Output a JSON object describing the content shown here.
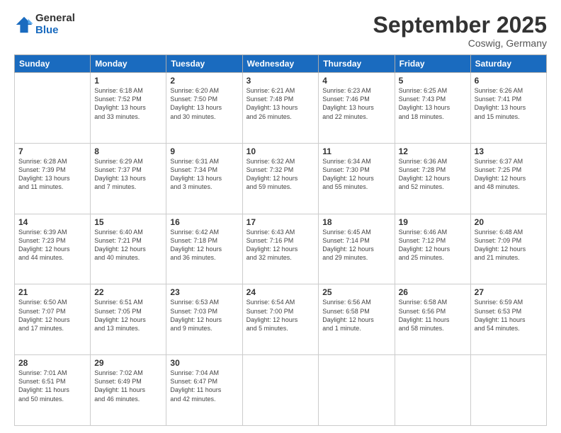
{
  "logo": {
    "general": "General",
    "blue": "Blue"
  },
  "title": "September 2025",
  "location": "Coswig, Germany",
  "days_header": [
    "Sunday",
    "Monday",
    "Tuesday",
    "Wednesday",
    "Thursday",
    "Friday",
    "Saturday"
  ],
  "weeks": [
    [
      {
        "day": "",
        "info": ""
      },
      {
        "day": "1",
        "info": "Sunrise: 6:18 AM\nSunset: 7:52 PM\nDaylight: 13 hours\nand 33 minutes."
      },
      {
        "day": "2",
        "info": "Sunrise: 6:20 AM\nSunset: 7:50 PM\nDaylight: 13 hours\nand 30 minutes."
      },
      {
        "day": "3",
        "info": "Sunrise: 6:21 AM\nSunset: 7:48 PM\nDaylight: 13 hours\nand 26 minutes."
      },
      {
        "day": "4",
        "info": "Sunrise: 6:23 AM\nSunset: 7:46 PM\nDaylight: 13 hours\nand 22 minutes."
      },
      {
        "day": "5",
        "info": "Sunrise: 6:25 AM\nSunset: 7:43 PM\nDaylight: 13 hours\nand 18 minutes."
      },
      {
        "day": "6",
        "info": "Sunrise: 6:26 AM\nSunset: 7:41 PM\nDaylight: 13 hours\nand 15 minutes."
      }
    ],
    [
      {
        "day": "7",
        "info": "Sunrise: 6:28 AM\nSunset: 7:39 PM\nDaylight: 13 hours\nand 11 minutes."
      },
      {
        "day": "8",
        "info": "Sunrise: 6:29 AM\nSunset: 7:37 PM\nDaylight: 13 hours\nand 7 minutes."
      },
      {
        "day": "9",
        "info": "Sunrise: 6:31 AM\nSunset: 7:34 PM\nDaylight: 13 hours\nand 3 minutes."
      },
      {
        "day": "10",
        "info": "Sunrise: 6:32 AM\nSunset: 7:32 PM\nDaylight: 12 hours\nand 59 minutes."
      },
      {
        "day": "11",
        "info": "Sunrise: 6:34 AM\nSunset: 7:30 PM\nDaylight: 12 hours\nand 55 minutes."
      },
      {
        "day": "12",
        "info": "Sunrise: 6:36 AM\nSunset: 7:28 PM\nDaylight: 12 hours\nand 52 minutes."
      },
      {
        "day": "13",
        "info": "Sunrise: 6:37 AM\nSunset: 7:25 PM\nDaylight: 12 hours\nand 48 minutes."
      }
    ],
    [
      {
        "day": "14",
        "info": "Sunrise: 6:39 AM\nSunset: 7:23 PM\nDaylight: 12 hours\nand 44 minutes."
      },
      {
        "day": "15",
        "info": "Sunrise: 6:40 AM\nSunset: 7:21 PM\nDaylight: 12 hours\nand 40 minutes."
      },
      {
        "day": "16",
        "info": "Sunrise: 6:42 AM\nSunset: 7:18 PM\nDaylight: 12 hours\nand 36 minutes."
      },
      {
        "day": "17",
        "info": "Sunrise: 6:43 AM\nSunset: 7:16 PM\nDaylight: 12 hours\nand 32 minutes."
      },
      {
        "day": "18",
        "info": "Sunrise: 6:45 AM\nSunset: 7:14 PM\nDaylight: 12 hours\nand 29 minutes."
      },
      {
        "day": "19",
        "info": "Sunrise: 6:46 AM\nSunset: 7:12 PM\nDaylight: 12 hours\nand 25 minutes."
      },
      {
        "day": "20",
        "info": "Sunrise: 6:48 AM\nSunset: 7:09 PM\nDaylight: 12 hours\nand 21 minutes."
      }
    ],
    [
      {
        "day": "21",
        "info": "Sunrise: 6:50 AM\nSunset: 7:07 PM\nDaylight: 12 hours\nand 17 minutes."
      },
      {
        "day": "22",
        "info": "Sunrise: 6:51 AM\nSunset: 7:05 PM\nDaylight: 12 hours\nand 13 minutes."
      },
      {
        "day": "23",
        "info": "Sunrise: 6:53 AM\nSunset: 7:03 PM\nDaylight: 12 hours\nand 9 minutes."
      },
      {
        "day": "24",
        "info": "Sunrise: 6:54 AM\nSunset: 7:00 PM\nDaylight: 12 hours\nand 5 minutes."
      },
      {
        "day": "25",
        "info": "Sunrise: 6:56 AM\nSunset: 6:58 PM\nDaylight: 12 hours\nand 1 minute."
      },
      {
        "day": "26",
        "info": "Sunrise: 6:58 AM\nSunset: 6:56 PM\nDaylight: 11 hours\nand 58 minutes."
      },
      {
        "day": "27",
        "info": "Sunrise: 6:59 AM\nSunset: 6:53 PM\nDaylight: 11 hours\nand 54 minutes."
      }
    ],
    [
      {
        "day": "28",
        "info": "Sunrise: 7:01 AM\nSunset: 6:51 PM\nDaylight: 11 hours\nand 50 minutes."
      },
      {
        "day": "29",
        "info": "Sunrise: 7:02 AM\nSunset: 6:49 PM\nDaylight: 11 hours\nand 46 minutes."
      },
      {
        "day": "30",
        "info": "Sunrise: 7:04 AM\nSunset: 6:47 PM\nDaylight: 11 hours\nand 42 minutes."
      },
      {
        "day": "",
        "info": ""
      },
      {
        "day": "",
        "info": ""
      },
      {
        "day": "",
        "info": ""
      },
      {
        "day": "",
        "info": ""
      }
    ]
  ]
}
